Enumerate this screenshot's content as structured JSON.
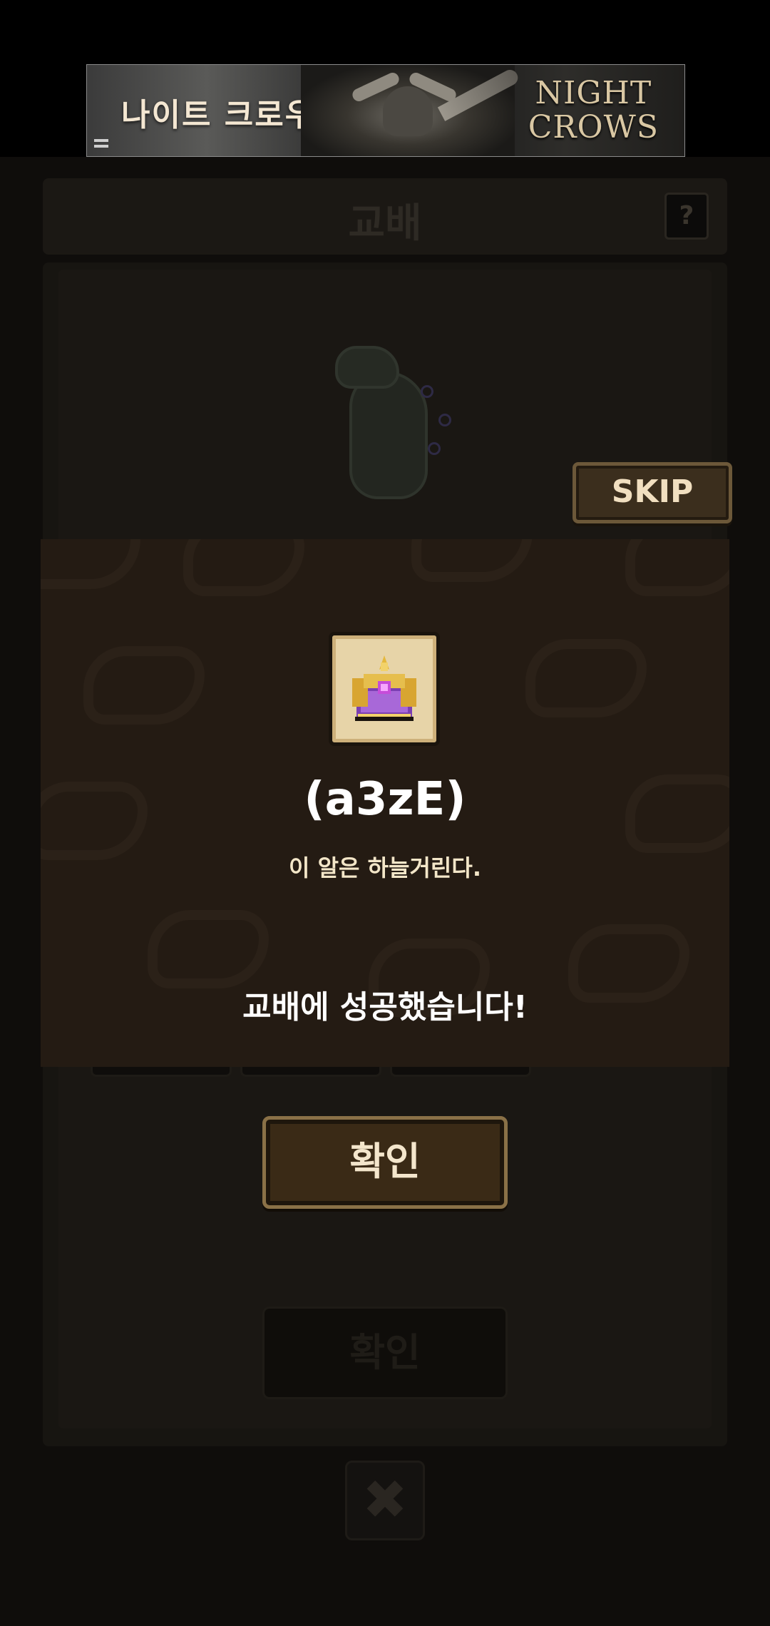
{
  "ad": {
    "title_left": "나이트 크로우",
    "title_right_line1": "NIGHT",
    "title_right_line2": "CROWS"
  },
  "header": {
    "title": "교배",
    "help_label": "?"
  },
  "skip_button": {
    "label": "SKIP"
  },
  "result": {
    "item_icon": "crown-icon",
    "item_name": "(a3zE)",
    "item_description": "이 알은 하늘거린다.",
    "message": "교배에 성공했습니다!"
  },
  "buttons": {
    "confirm_label": "확인",
    "confirm_dim_label": "확인",
    "close_label": "✖"
  },
  "colors": {
    "modal_bg": "#241b13",
    "button_border": "#8a7147",
    "text_cream": "#f3e6c8"
  }
}
